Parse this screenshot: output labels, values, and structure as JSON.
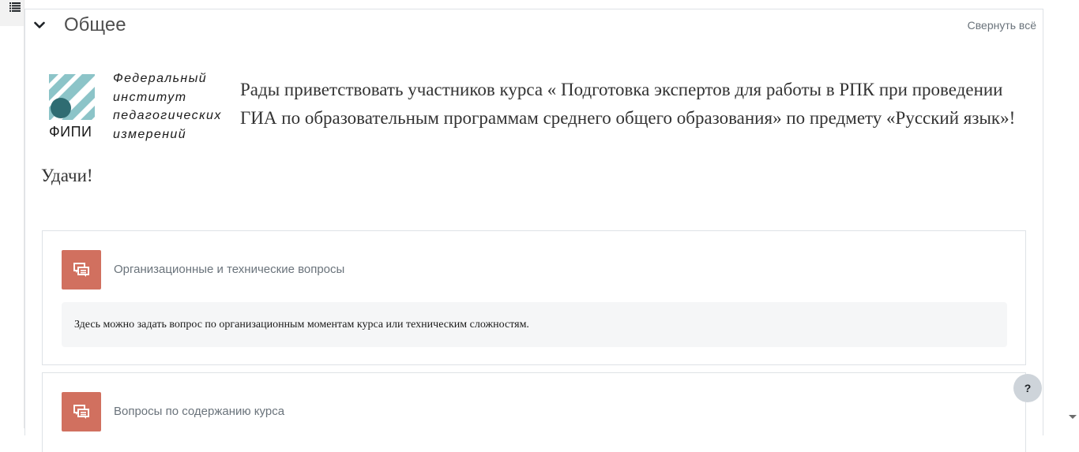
{
  "drawer": {
    "icon": "list-icon"
  },
  "section": {
    "title": "Общее",
    "collapse_all": "Свернуть всё",
    "chevron_icon": "chevron-down-icon"
  },
  "logo": {
    "acronym": "ФИПИ",
    "lines": [
      "Федеральный",
      "институт",
      "педагогических",
      "измерений"
    ],
    "colors": {
      "teal": "#2f6c72",
      "stripe": "#8cc4c8"
    }
  },
  "welcome_text": "Рады приветствовать участников курса « Подготовка экспертов для работы в РПК при проведении ГИА по образовательным программам среднего общего образования» по предмету «Русский язык»!",
  "luck_text": "Удачи!",
  "activities": [
    {
      "icon": "forum-icon",
      "title": "Организационные и технические вопросы",
      "description": "Здесь можно задать вопрос по организационным моментам курса или техническим сложностям."
    },
    {
      "icon": "forum-icon",
      "title": "Вопросы по содержанию курса"
    }
  ],
  "help_button": "?",
  "colors": {
    "accent": "#d1705f",
    "muted_text": "#6a737b",
    "border": "#dee2e6"
  }
}
